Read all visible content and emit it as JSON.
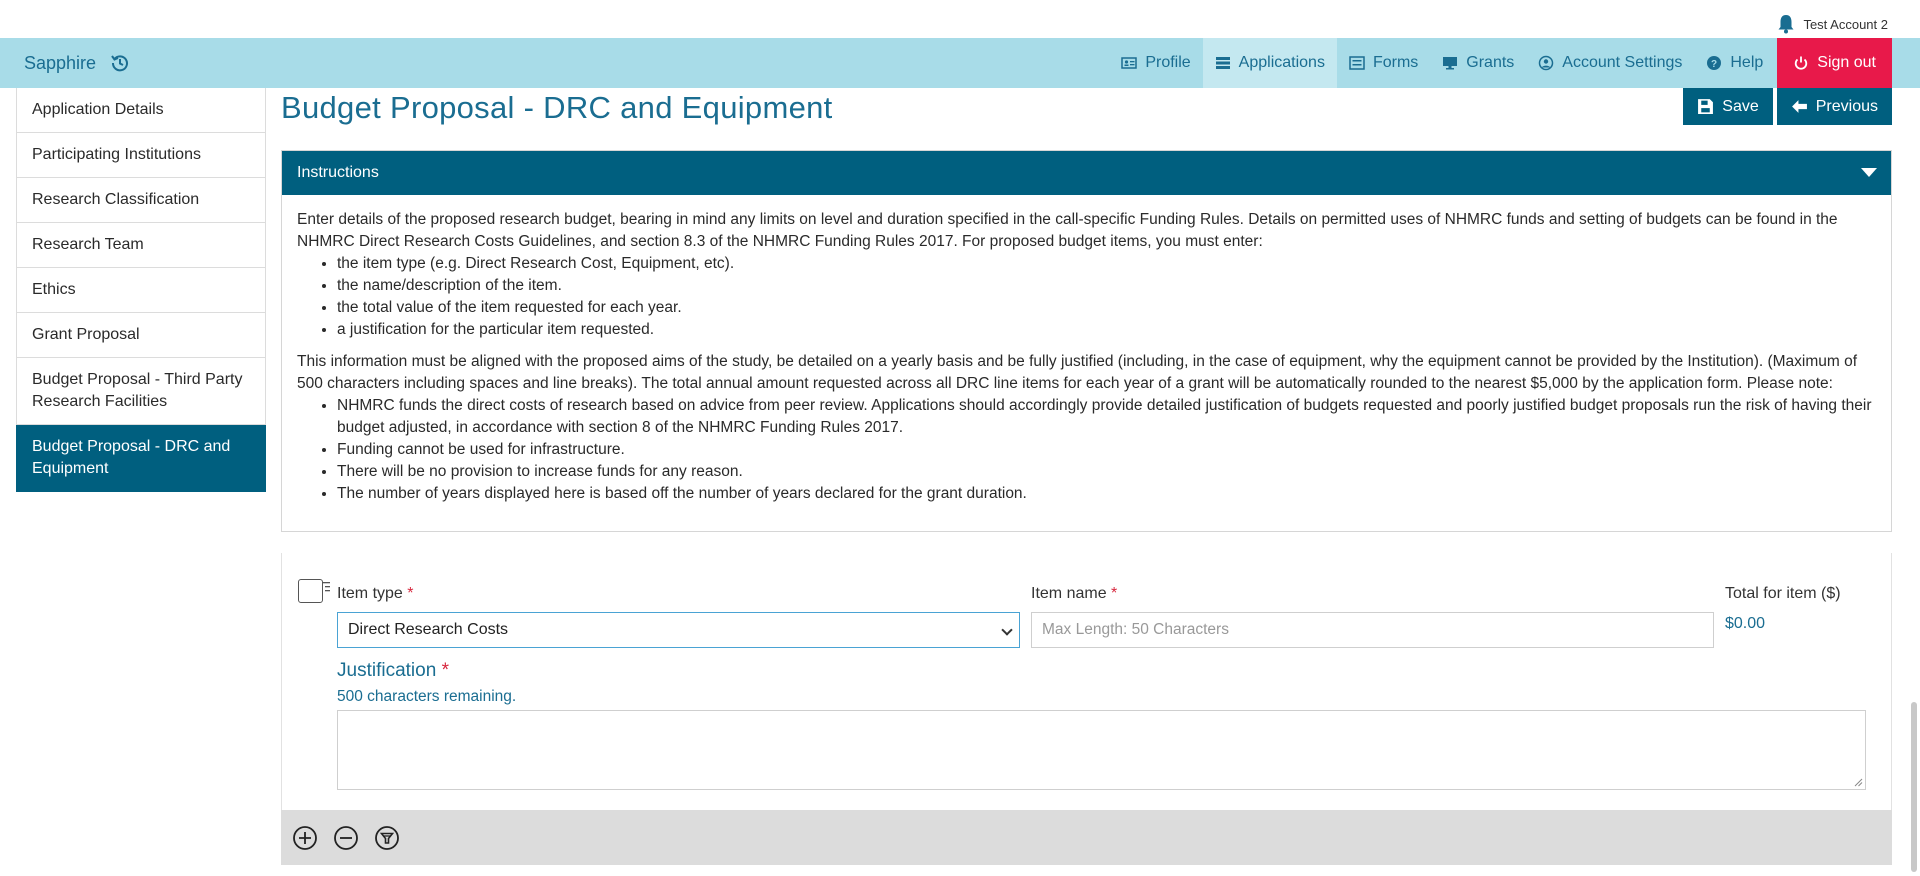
{
  "account": {
    "name": "Test Account 2",
    "icon": "bell-icon"
  },
  "brand": {
    "name": "Sapphire",
    "history_icon": "history-icon"
  },
  "nav": {
    "profile": "Profile",
    "applications": "Applications",
    "forms": "Forms",
    "grants": "Grants",
    "account_settings": "Account Settings",
    "help": "Help",
    "sign_out": "Sign out"
  },
  "sidebar": {
    "items": [
      {
        "label": "Application Details"
      },
      {
        "label": "Participating Institutions"
      },
      {
        "label": "Research Classification"
      },
      {
        "label": "Research Team"
      },
      {
        "label": "Ethics"
      },
      {
        "label": "Grant Proposal"
      },
      {
        "label": "Budget Proposal - Third Party Research Facilities"
      },
      {
        "label": "Budget Proposal - DRC and Equipment"
      }
    ],
    "active_index": 7
  },
  "page": {
    "title": "Budget Proposal - DRC and Equipment",
    "save": "Save",
    "previous": "Previous"
  },
  "instructions": {
    "heading": "Instructions",
    "intro": "Enter details of the proposed research budget, bearing in mind any limits on level and duration specified in the call-specific Funding Rules. Details on permitted uses of NHMRC funds and setting of budgets can be found in the NHMRC Direct Research Costs Guidelines, and section 8.3 of the NHMRC Funding Rules 2017. For proposed budget items, you must enter:",
    "required": [
      "the item type (e.g. Direct Research Cost, Equipment, etc).",
      "the name/description of the item.",
      "the total value of the item requested for each year.",
      "a justification for the particular item requested."
    ],
    "alignment": "This information must be aligned with the proposed aims of the study, be detailed on a yearly basis and be fully justified (including, in the case of equipment, why the equipment cannot be provided by the Institution). (Maximum of 500 characters including spaces and line breaks). The total annual amount requested across all DRC line items for each year of a grant will be automatically rounded to the nearest $5,000 by the application form. Please note:",
    "notes": [
      "NHMRC funds the direct costs of research based on advice from peer review. Applications should accordingly provide detailed justification of budgets requested and poorly justified budget proposals run the risk of having their budget adjusted, in accordance with section 8 of the NHMRC Funding Rules 2017.",
      "Funding cannot be used for infrastructure.",
      "There will be no provision to increase funds for any reason.",
      "The number of years displayed here is based off the number of years declared for the grant duration."
    ]
  },
  "item": {
    "type_label": "Item type",
    "type_value": "Direct Research Costs",
    "name_label": "Item name",
    "name_placeholder": "Max Length: 50 Characters",
    "total_label": "Total for item ($)",
    "total_value": "$0.00",
    "required_marker": "*",
    "justification_label": "Justification",
    "remaining": "500 characters remaining."
  },
  "toolbar": {
    "icons": [
      "add-icon",
      "remove-icon",
      "filter-icon"
    ]
  },
  "colors": {
    "primary": "#005f7f",
    "nav_bg": "#a8dce8",
    "signout": "#e8194a",
    "link": "#1a6d91"
  }
}
